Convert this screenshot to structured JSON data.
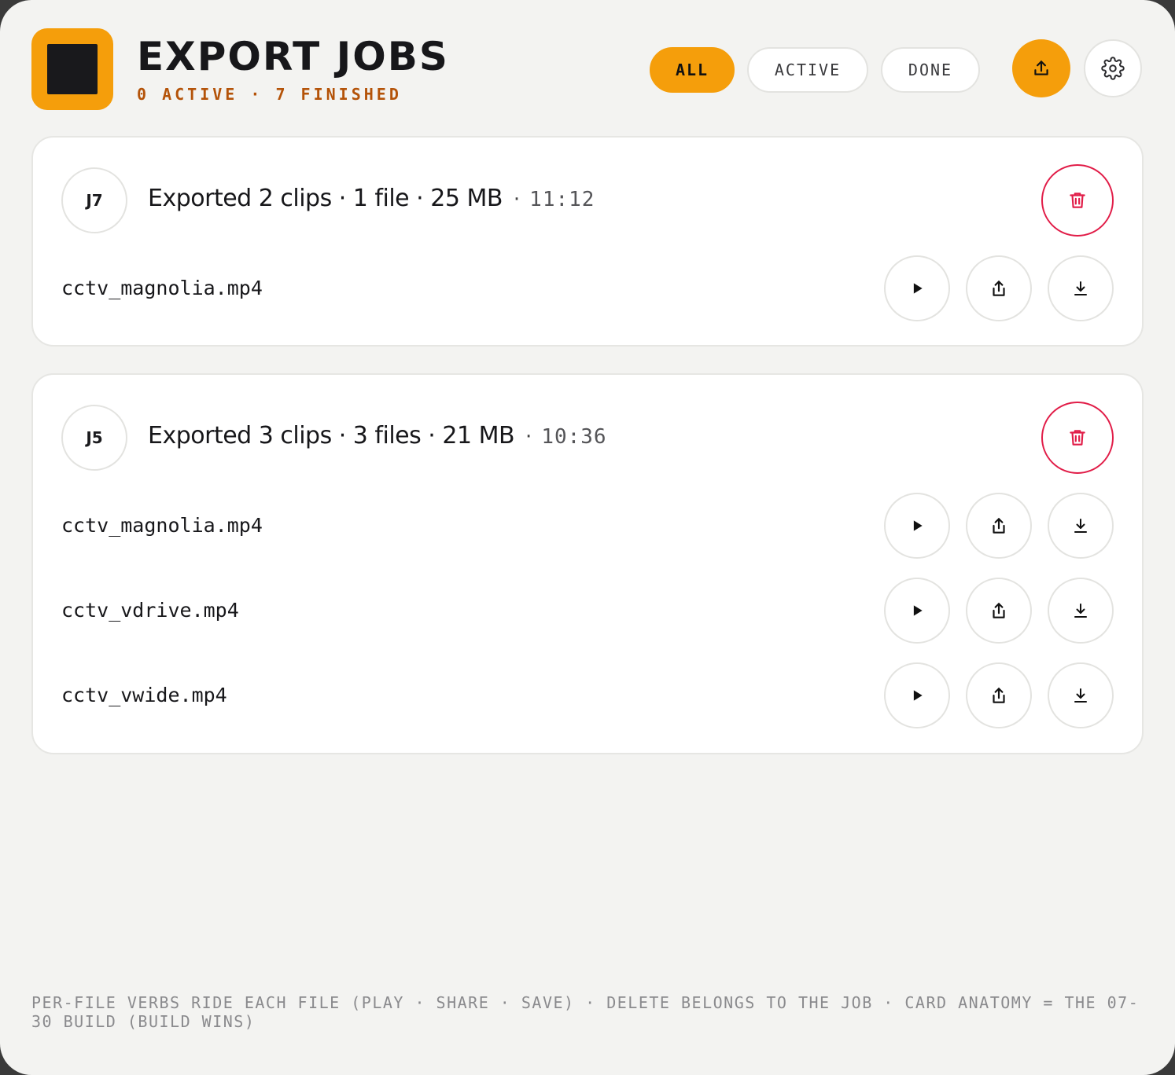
{
  "header": {
    "title": "EXPORT JOBS",
    "subtitle": "0 ACTIVE · 7 FINISHED",
    "filters": [
      {
        "label": "ALL",
        "selected": true
      },
      {
        "label": "ACTIVE",
        "selected": false
      },
      {
        "label": "DONE",
        "selected": false
      }
    ],
    "export_icon": "upload-icon",
    "settings_icon": "gear-icon"
  },
  "jobs": [
    {
      "id": "J7",
      "summary": "Exported 2 clips · 1 file · 25 MB",
      "separator": "·",
      "time": "11:12",
      "files": [
        {
          "name": "cctv_magnolia.mp4"
        }
      ]
    },
    {
      "id": "J5",
      "summary": "Exported 3 clips · 3 files · 21 MB",
      "separator": "·",
      "time": "10:36",
      "files": [
        {
          "name": "cctv_magnolia.mp4"
        },
        {
          "name": "cctv_vdrive.mp4"
        },
        {
          "name": "cctv_vwide.mp4"
        }
      ]
    }
  ],
  "footer": "PER-FILE VERBS RIDE EACH FILE (PLAY · SHARE · SAVE) · DELETE BELONGS TO THE JOB · CARD ANATOMY = THE 07-30 BUILD (BUILD WINS)",
  "colors": {
    "accent": "#f59e0b",
    "subtitle": "#b45309",
    "danger": "#e11d48",
    "background": "#f3f3f1"
  }
}
